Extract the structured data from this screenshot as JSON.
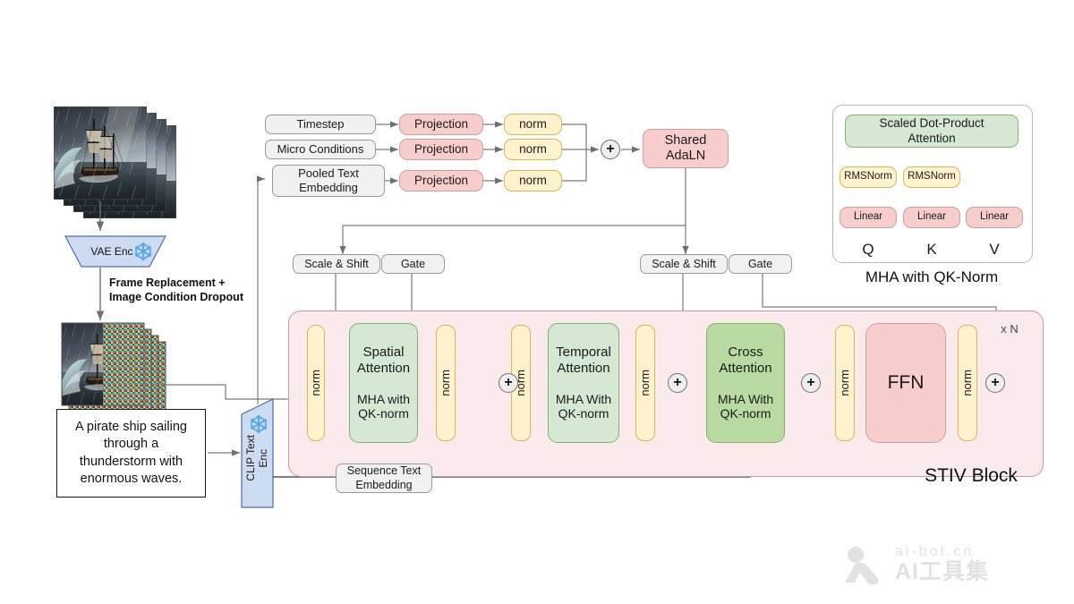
{
  "figure": {
    "title": "STIV video generation model architecture",
    "watermark": {
      "line1": "ai-bot.cn",
      "line2": "AI工具集"
    }
  },
  "colors": {
    "grey_fill": "#f1f1f1",
    "pink_fill": "#f8cecc",
    "yellow_fill": "#fff2cc",
    "green_fill": "#d5e8d4",
    "green_strong_fill": "#b9dba2",
    "block_fill": "#fbeaec",
    "encoder_fill": "#ccddf2",
    "edge": "#7a7a7a"
  },
  "inputs": {
    "video_frames_label": "video frame stack",
    "vae_encoder": {
      "label": "VAE Enc",
      "frozen_icon": "snowflake-icon"
    },
    "edge_caption": "Frame Replacement +\nImage Condition Dropout",
    "edge_caption_line1": "Frame Replacement +",
    "edge_caption_line2": "Image Condition Dropout",
    "noised_frames_label": "noised latent frame stack",
    "prompt_text": "A pirate ship sailing through a thunderstorm with enormous waves.",
    "clip_encoder": {
      "label_line1": "CLIP Text",
      "label_line2": "Enc",
      "frozen_icon": "snowflake-icon"
    }
  },
  "conditioning": {
    "rows": [
      {
        "source": "Timestep",
        "projection": "Projection",
        "norm": "norm"
      },
      {
        "source": "Micro Conditions",
        "projection": "Projection",
        "norm": "norm"
      },
      {
        "source": "Pooled Text Embedding",
        "projection": "Projection",
        "norm": "norm"
      }
    ],
    "sum_symbol": "+",
    "adaln": "Shared AdaLN"
  },
  "modulation": {
    "left": {
      "scale_shift": "Scale & Shift",
      "gate": "Gate"
    },
    "right": {
      "scale_shift": "Scale & Shift",
      "gate": "Gate"
    }
  },
  "stiv_block": {
    "title": "STIV Block",
    "repeat": "x N",
    "norm_label": "norm",
    "sum_symbol": "+",
    "sequence_text_embedding": "Sequence Text Embedding",
    "sequence_text_embedding_line1": "Sequence Text",
    "sequence_text_embedding_line2": "Embedding",
    "stages": [
      {
        "name": "Spatial Attention",
        "title_line1": "Spatial",
        "title_line2": "Attention",
        "sub_line1": "MHA with",
        "sub_line2": "QK-norm"
      },
      {
        "name": "Temporal Attention",
        "title_line1": "Temporal",
        "title_line2": "Attention",
        "sub_line1": "MHA With",
        "sub_line2": "QK-norm"
      },
      {
        "name": "Cross Attention",
        "title_line1": "Cross",
        "title_line2": "Attention",
        "sub_line1": "MHA With",
        "sub_line2": "QK-norm"
      }
    ],
    "ffn": "FFN"
  },
  "mha_panel": {
    "caption": "MHA with QK-Norm",
    "attention": "Scaled Dot-Product Attention",
    "attention_line1": "Scaled Dot-Product",
    "attention_line2": "Attention",
    "columns": [
      {
        "input": "Q",
        "linear": "Linear",
        "norm": "RMSNorm",
        "has_norm": true
      },
      {
        "input": "K",
        "linear": "Linear",
        "norm": "RMSNorm",
        "has_norm": true
      },
      {
        "input": "V",
        "linear": "Linear",
        "norm": "",
        "has_norm": false
      }
    ]
  }
}
